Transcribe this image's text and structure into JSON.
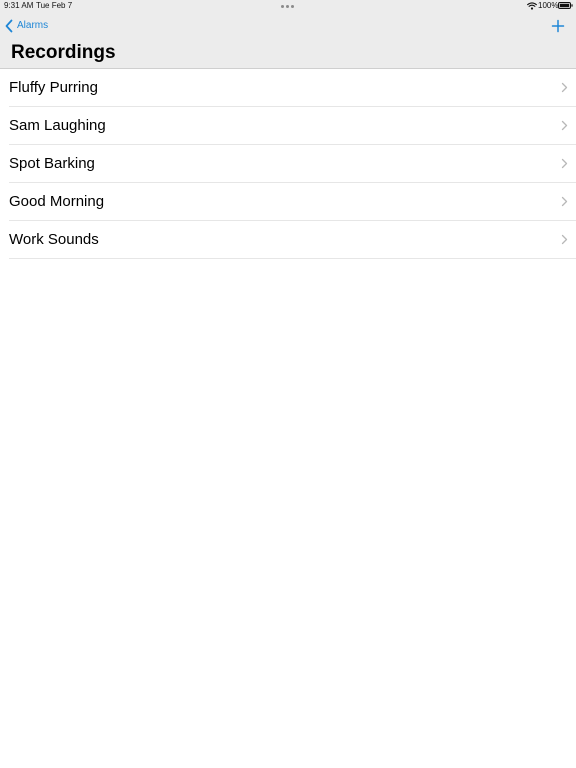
{
  "status_bar": {
    "time": "9:31 AM",
    "date": "Tue Feb 7",
    "battery": "100%",
    "icons": [
      "more-dots-icon",
      "wifi-icon",
      "battery-icon"
    ]
  },
  "nav": {
    "back_label": "Alarms",
    "back_icon": "chevron-left-icon",
    "add_icon": "plus-icon",
    "accent_color": "#1e86d6"
  },
  "page": {
    "title": "Recordings"
  },
  "recordings": [
    {
      "label": "Fluffy Purring"
    },
    {
      "label": "Sam Laughing"
    },
    {
      "label": "Spot Barking"
    },
    {
      "label": "Good Morning"
    },
    {
      "label": "Work Sounds"
    }
  ],
  "colors": {
    "header_background": "#ececec",
    "separator": "#e6e6e6",
    "chevron": "#b8b8b8"
  }
}
